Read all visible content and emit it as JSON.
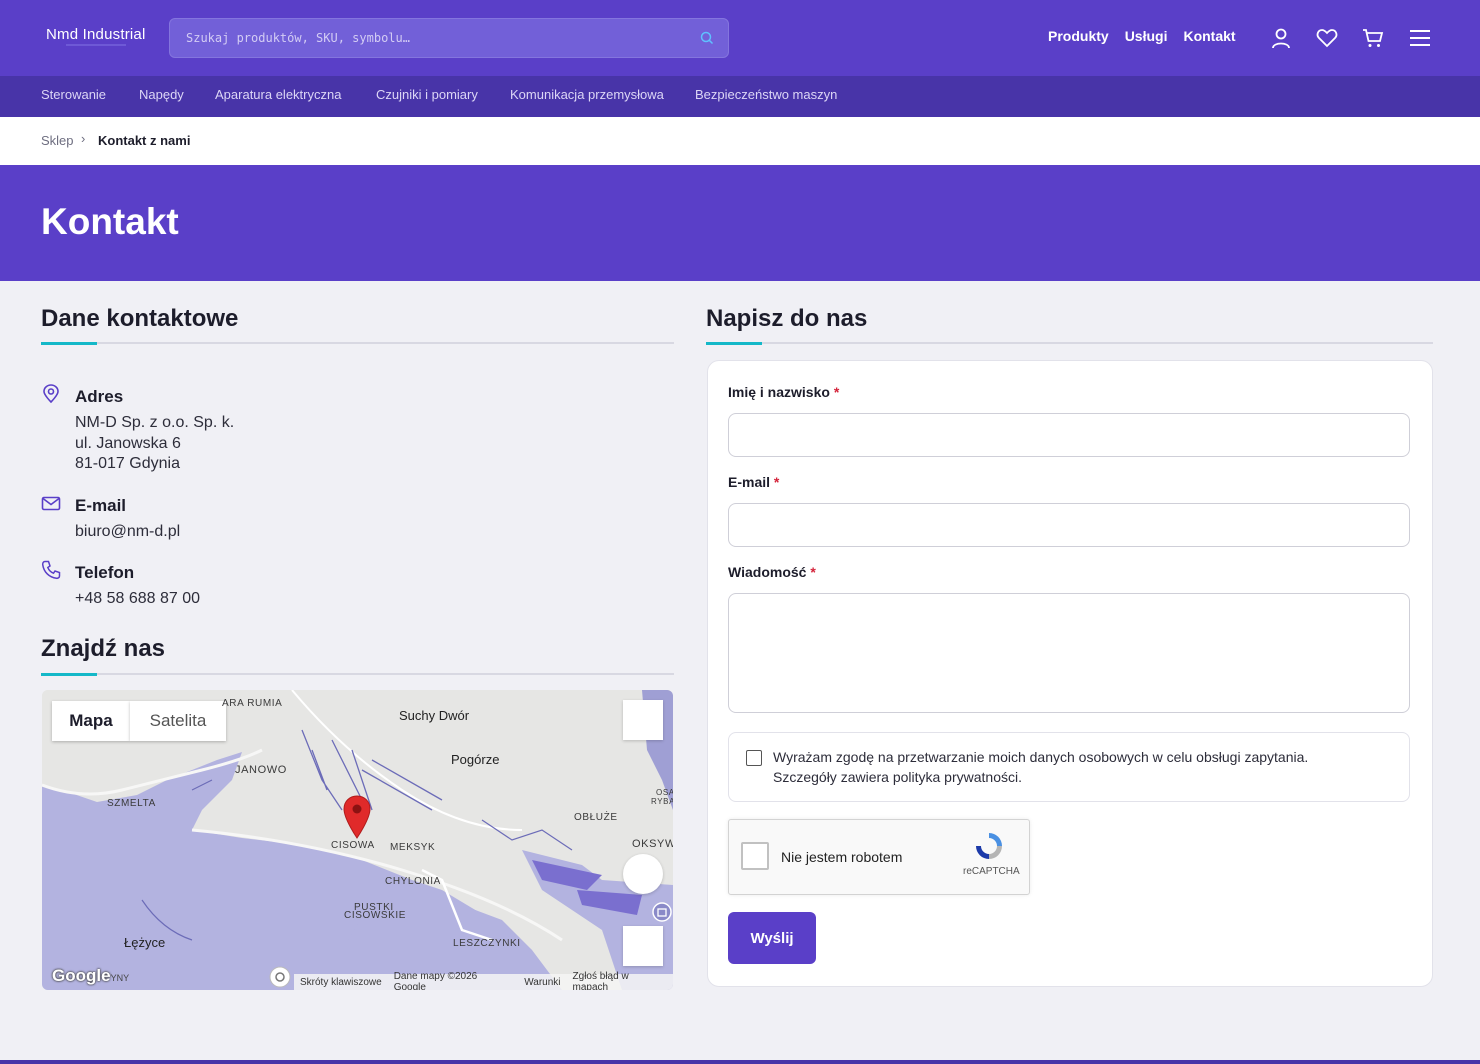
{
  "header": {
    "logo": "Nmd Industrial",
    "search_placeholder": "Szukaj produktów, SKU, symbolu…",
    "nav": [
      "Produkty",
      "Usługi",
      "Kontakt"
    ],
    "icons": [
      "user-icon",
      "heart-icon",
      "cart-icon",
      "menu-icon"
    ]
  },
  "categories": [
    "Sterowanie",
    "Napędy",
    "Aparatura elektryczna",
    "Czujniki i pomiary",
    "Komunikacja przemysłowa",
    "Bezpieczeństwo maszyn"
  ],
  "breadcrumb": {
    "home": "Sklep",
    "separator": "›",
    "current": "Kontakt z nami"
  },
  "hero": {
    "title": "Kontakt"
  },
  "contact": {
    "title": "Dane kontaktowe",
    "address": {
      "label": "Adres",
      "lines": [
        "NM-D Sp. z o.o. Sp. k.",
        "ul. Janowska 6",
        "81-017 Gdynia"
      ]
    },
    "email": {
      "label": "E-mail",
      "value": "biuro@nm-d.pl"
    },
    "phone": {
      "label": "Telefon",
      "value": "+48 58 688 87 00"
    }
  },
  "map_section": {
    "title": "Znajdź nas",
    "tab_map": "Mapa",
    "tab_satellite": "Satelita",
    "places": [
      "ARA RUMIA",
      "Suchy Dwór",
      "Pogórze",
      "JANOWO",
      "SZMELTA",
      "OBŁUŻE",
      "MEKSYK",
      "CISOWA",
      "OKSYW",
      "CHYLONIA",
      "PUSTKI",
      "CISOWSKIE",
      "Łężyce",
      "LESZCZYNKI",
      "OSA",
      "RYBA"
    ],
    "google": "Google",
    "google_suffix": "YNY",
    "footer": [
      "Skróty klawiszowe",
      "Dane mapy ©2026 Google",
      "Warunki",
      "Zgłoś błąd w mapach"
    ]
  },
  "form": {
    "title": "Napisz do nas",
    "name_label": "Imię i nazwisko",
    "email_label": "E-mail",
    "message_label": "Wiadomość",
    "required_mark": "*",
    "consent_line1": "Wyrażam zgodę na przetwarzanie moich danych osobowych w celu obsługi zapytania.",
    "consent_line2": "Szczegóły zawiera polityka prywatności.",
    "recaptcha_text": "Nie jestem robotem",
    "recaptcha_brand": "reCAPTCHA",
    "submit": "Wyślij"
  },
  "colors": {
    "primary": "#5a3fc8",
    "primary_dark": "#4834a8",
    "accent": "#14b8c8",
    "required": "#d4233a",
    "map_water": "#b3b3e0"
  }
}
